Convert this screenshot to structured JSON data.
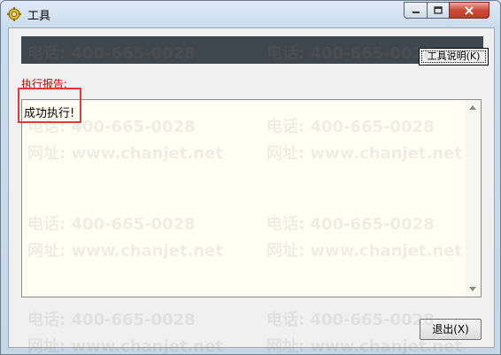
{
  "window": {
    "title": "工具"
  },
  "header": {
    "tool_info_button": "工具说明(K)"
  },
  "report": {
    "label": "执行报告:",
    "content": "成功执行!"
  },
  "footer": {
    "exit_button": "退出(X)"
  },
  "watermark": {
    "phone": "电话: 400-665-0028",
    "site": "网址: www.chanjet.net"
  },
  "colors": {
    "header_band": "#3f474e",
    "label_red": "#cc0000",
    "highlight": "#e23a3a",
    "report_bg": "#fffff4"
  },
  "icons": [
    "app-gear-icon",
    "minimize-icon",
    "maximize-icon",
    "close-icon",
    "scroll-up-icon",
    "scroll-down-icon"
  ]
}
